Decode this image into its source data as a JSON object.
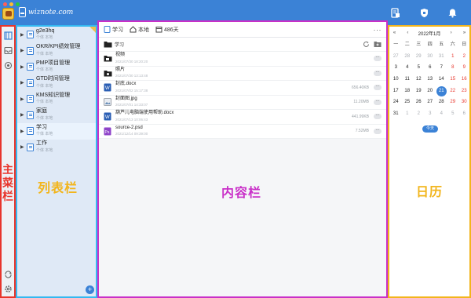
{
  "topbar": {
    "logo_text": "wiznote.com",
    "icons": [
      "new-note-icon",
      "shield-icon",
      "bell-icon"
    ],
    "colors": {
      "bar": "#3b82d6",
      "traffic_red": "#ff5f57",
      "traffic_yellow": "#febc2e",
      "traffic_green": "#28c840"
    }
  },
  "mainbar": {
    "label": "主菜栏",
    "icons": [
      "notes-icon",
      "inbox-icon",
      "settings-icon"
    ],
    "bottom_icons": [
      "sync-icon",
      "gear-icon"
    ]
  },
  "listbar": {
    "label": "列表栏",
    "items": [
      {
        "title": "g2e3hq",
        "meta": "个体  本地"
      },
      {
        "title": "OKR/KPI绩效管理",
        "meta": "个体  本地"
      },
      {
        "title": "PMP项目管理",
        "meta": "个体  本地"
      },
      {
        "title": "GTD时间管理",
        "meta": "个体  本地"
      },
      {
        "title": "KMS知识管理",
        "meta": "个体  本地"
      },
      {
        "title": "家庭",
        "meta": "个体  本地"
      },
      {
        "title": "学习",
        "meta": "个体  本地"
      },
      {
        "title": "工作",
        "meta": "个体  本地"
      }
    ],
    "add_label": "+"
  },
  "content": {
    "label": "内容栏",
    "breadcrumb": [
      {
        "label": "学习",
        "icon": "book-icon"
      },
      {
        "label": "本地",
        "icon": "home-icon"
      },
      {
        "label": "486天",
        "icon": "calendar-icon"
      }
    ],
    "more": "···",
    "folder": "学习",
    "files": [
      {
        "name": "视频",
        "date": "2021/07/30 18:20:20",
        "size": "",
        "type": "folder"
      },
      {
        "name": "照片",
        "date": "2021/07/30 13:13:48",
        "size": "",
        "type": "folder"
      },
      {
        "name": "封底.docx",
        "date": "2021/07/02 15:17:38",
        "size": "656.40KB",
        "type": "word"
      },
      {
        "name": "封面图.jpg",
        "date": "2021/07/01 14:33:07",
        "size": "11.20MB",
        "type": "image"
      },
      {
        "name": "葫芦儿电脑端使用帮助.docx",
        "date": "2021/07/13 10:06:43",
        "size": "441.99KB",
        "type": "word"
      },
      {
        "name": "source-2.psd",
        "date": "2021/12/14 09:39:00",
        "size": "7.52MB",
        "type": "psd"
      }
    ],
    "row_more": "···"
  },
  "calendar": {
    "label": "日历",
    "nav": {
      "prev_year": "«",
      "prev_month": "‹",
      "title": "2022年1月",
      "next_month": "›",
      "next_year": "»"
    },
    "weekdays": [
      "一",
      "二",
      "三",
      "四",
      "五",
      "六",
      "日"
    ],
    "days": [
      [
        "27",
        "28",
        "29",
        "30",
        "31",
        "1",
        "2"
      ],
      [
        "3",
        "4",
        "5",
        "6",
        "7",
        "8",
        "9"
      ],
      [
        "10",
        "11",
        "12",
        "13",
        "14",
        "15",
        "16"
      ],
      [
        "17",
        "18",
        "19",
        "20",
        "21",
        "22",
        "23"
      ],
      [
        "24",
        "25",
        "26",
        "27",
        "28",
        "29",
        "30"
      ],
      [
        "31",
        "1",
        "2",
        "3",
        "4",
        "5",
        "6"
      ]
    ],
    "today_day": "21",
    "today_label": "今天"
  }
}
